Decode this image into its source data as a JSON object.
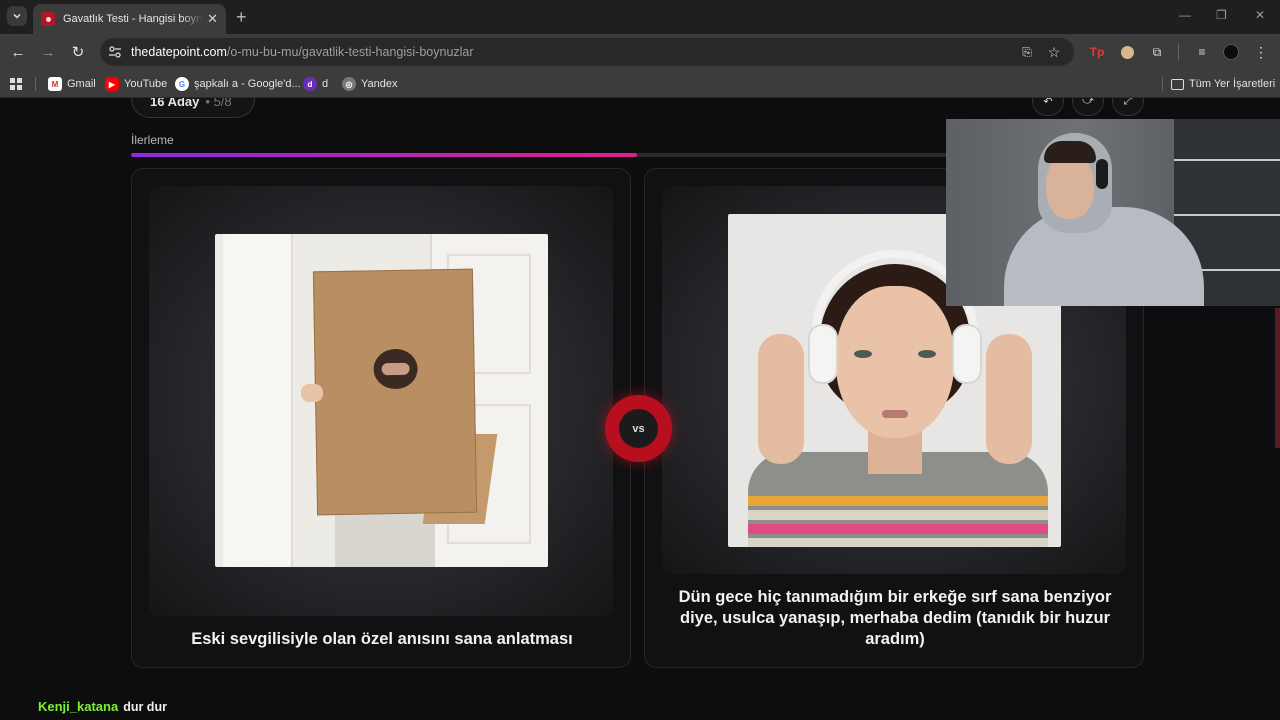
{
  "browser": {
    "tab_title": "Gavatlık Testi - Hangisi boynuzlar",
    "url_domain": "thedatepoint.com",
    "url_path": "/o-mu-bu-mu/gavatlik-testi-hangisi-boynuzlar",
    "bookmarks": [
      {
        "label": "Gmail",
        "icon": "gmail-icon"
      },
      {
        "label": "YouTube",
        "icon": "youtube-icon"
      },
      {
        "label": "şapkalı a - Google'd...",
        "icon": "google-icon"
      },
      {
        "label": "d",
        "icon": "bookmark-icon"
      },
      {
        "label": "Yandex",
        "icon": "globe-icon"
      }
    ],
    "all_bookmarks_label": "Tüm Yer İşaretleri",
    "accent": "#3c3c3c"
  },
  "quiz": {
    "candidates": "16 Aday",
    "round": "5/8",
    "progress_label": "İlerleme",
    "progress": 0.5,
    "progress_colors": [
      "#8a2be2",
      "#e0208a"
    ],
    "vs_label": "vs",
    "left_caption": "Eski sevgilisiyle olan özel anısını sana anlatması",
    "right_caption": "Dün gece hiç tanımadığım bir erkeğe sırf sana benziyor diye, usulca yanaşıp, merhaba dedim (tanıdık bir huzur aradım)",
    "vs_color": "#b80f1f"
  },
  "chat": {
    "username": "Kenji_katana",
    "message": "dur dur",
    "username_color": "#7cf036"
  }
}
